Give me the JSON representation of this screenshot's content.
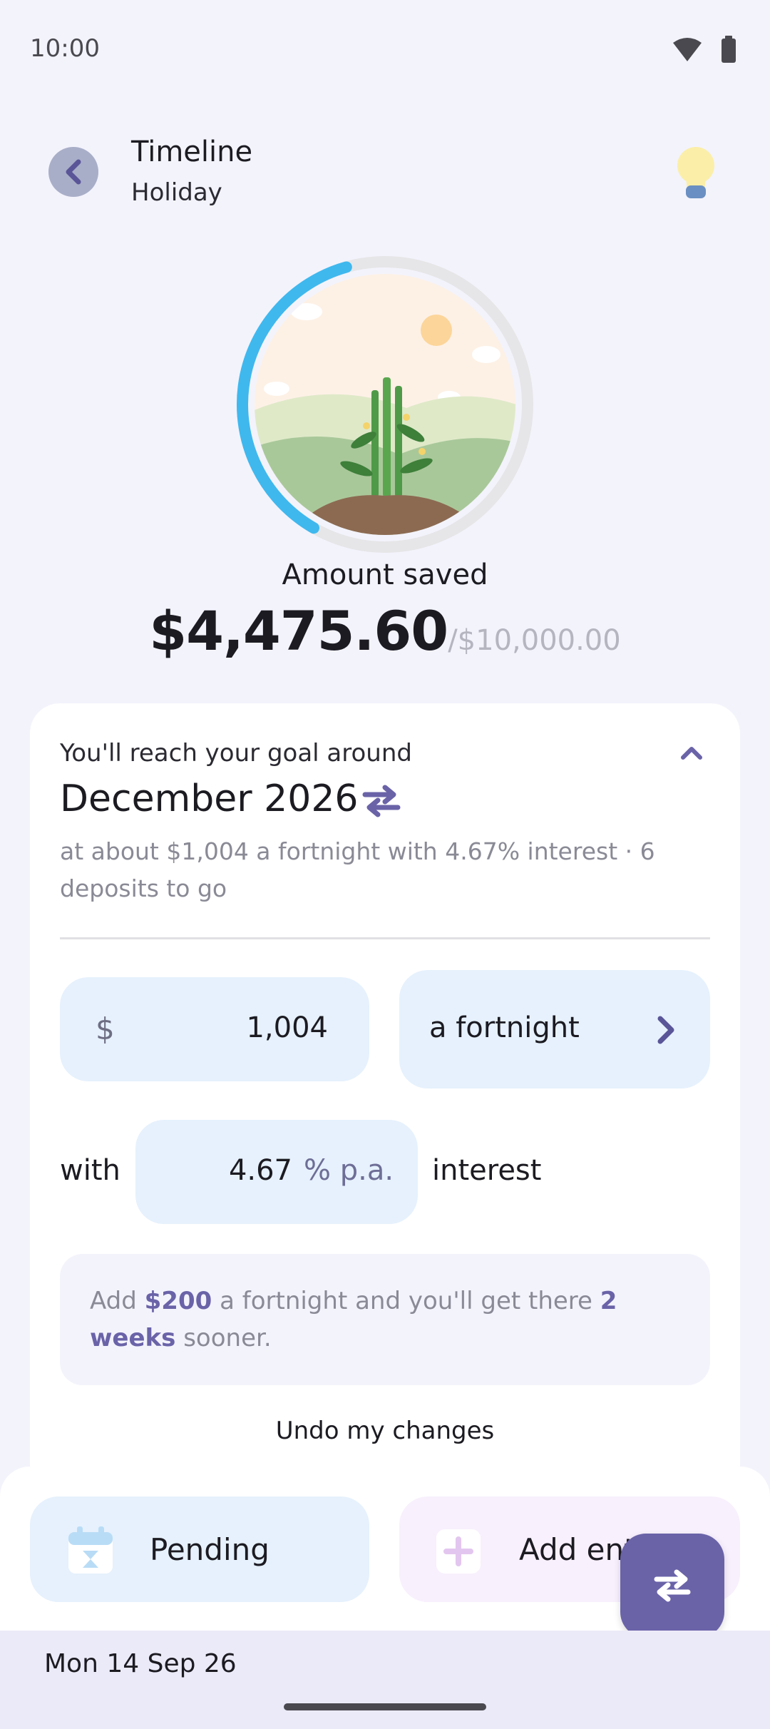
{
  "status_bar": {
    "time": "10:00"
  },
  "header": {
    "title": "Timeline",
    "subtitle": "Holiday"
  },
  "progress": {
    "fraction": 0.4476
  },
  "summary": {
    "label": "Amount saved",
    "saved": "$4,475.60",
    "target": "/$10,000.00"
  },
  "goal": {
    "intro": "You'll reach your goal around",
    "date": "December 2026",
    "detail": "at about $1,004 a fortnight with 4.67% interest · 6 deposits to go"
  },
  "deposit": {
    "currency": "$",
    "amount": "1,004",
    "frequency": "a fortnight"
  },
  "rate": {
    "with_label": "with",
    "value": "4.67",
    "unit": "% p.a.",
    "suffix": "interest"
  },
  "tip": {
    "part1": "Add ",
    "amount": "$200",
    "part2": " a fortnight and you'll get there ",
    "duration_num": "2",
    "duration_unit": "weeks",
    "part3": " sooner."
  },
  "actions": {
    "undo": "Undo my changes",
    "pending": "Pending",
    "add_entry": "Add entry"
  },
  "footer": {
    "date": "Mon 14 Sep 26"
  },
  "colors": {
    "accent": "#6a63a8",
    "ring_progress": "#3fb8ee",
    "ring_track": "#e6e6e8",
    "field_bg": "#e6f1fd"
  }
}
